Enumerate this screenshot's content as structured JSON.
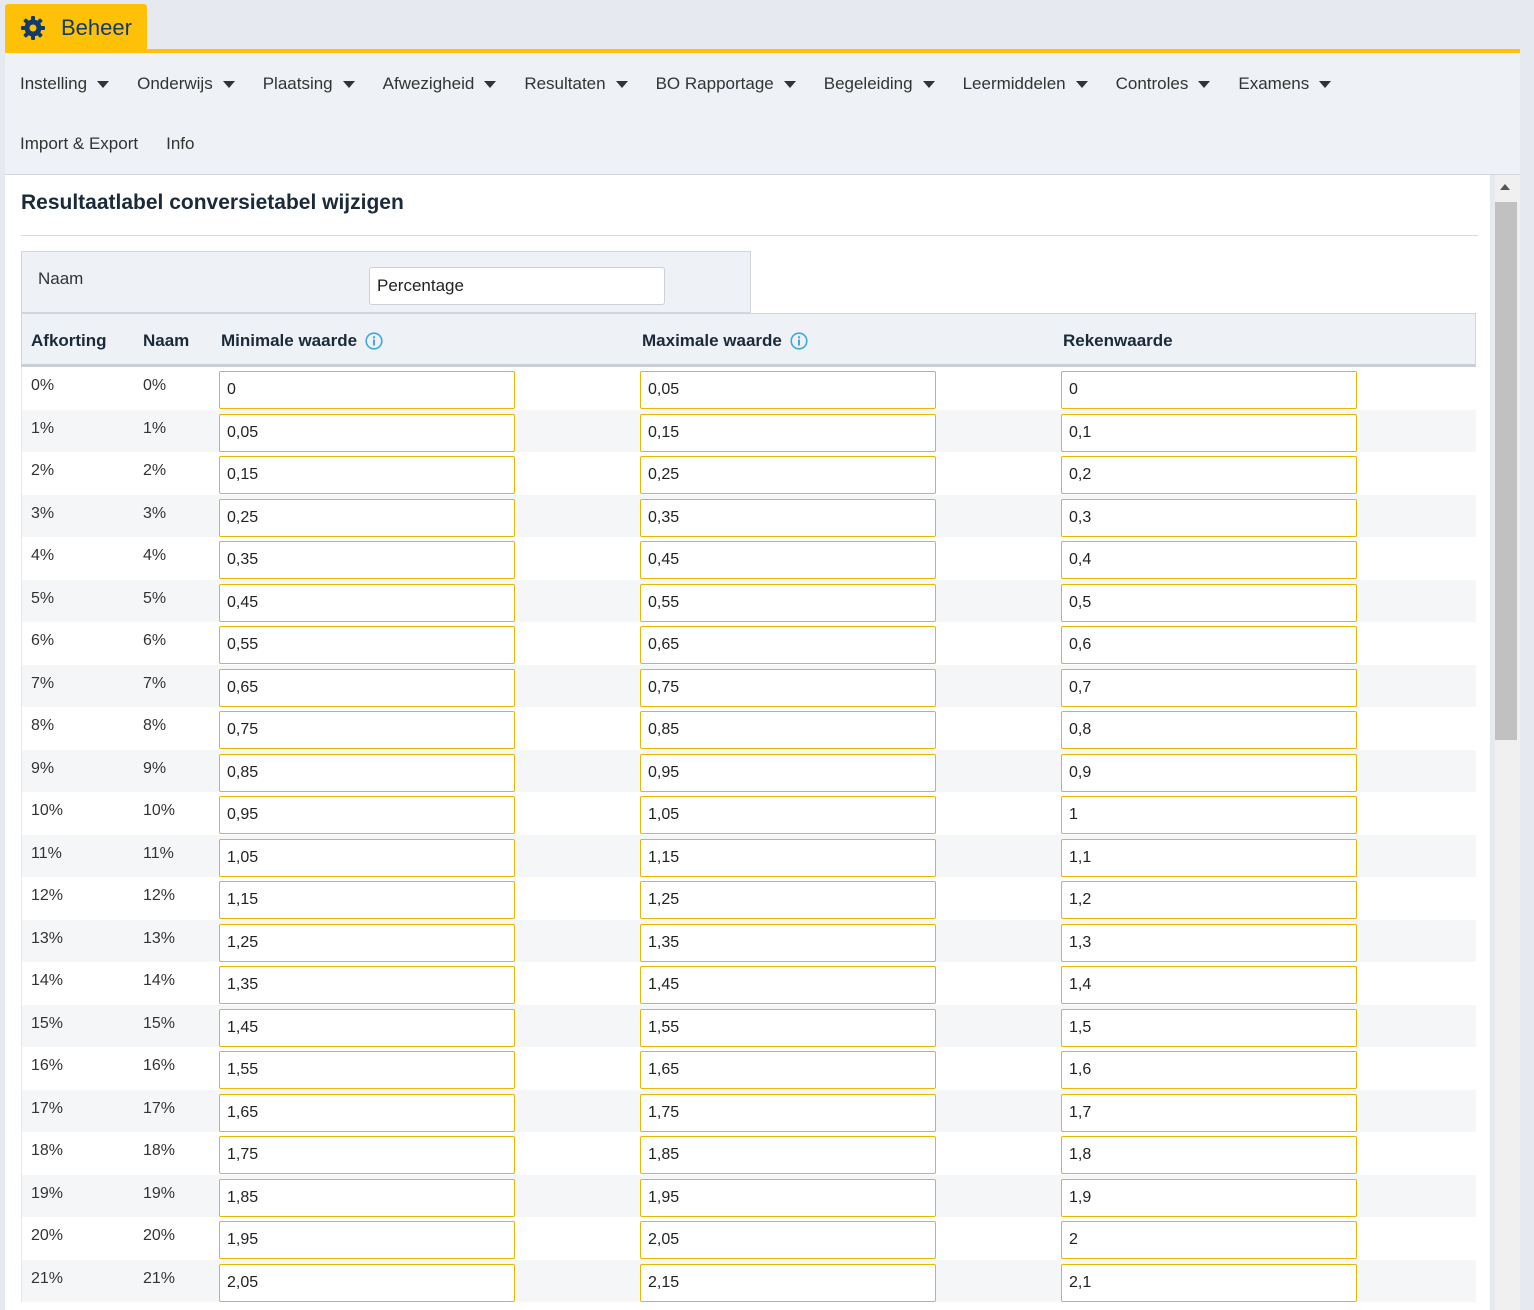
{
  "app": {
    "tab_label": "Beheer"
  },
  "menu": {
    "row1": [
      "Instelling",
      "Onderwijs",
      "Plaatsing",
      "Afwezigheid",
      "Resultaten",
      "BO Rapportage",
      "Begeleiding",
      "Leermiddelen",
      "Controles",
      "Examens"
    ],
    "row2": [
      "Import & Export",
      "Info"
    ]
  },
  "page": {
    "title": "Resultaatlabel conversietabel wijzigen"
  },
  "form": {
    "naam_label": "Naam",
    "naam_value": "Percentage"
  },
  "table": {
    "headers": {
      "afkorting": "Afkorting",
      "naam": "Naam",
      "min": "Minimale waarde",
      "max": "Maximale waarde",
      "reken": "Rekenwaarde"
    },
    "rows": [
      [
        "0%",
        "0%",
        "0",
        "0,05",
        "0"
      ],
      [
        "1%",
        "1%",
        "0,05",
        "0,15",
        "0,1"
      ],
      [
        "2%",
        "2%",
        "0,15",
        "0,25",
        "0,2"
      ],
      [
        "3%",
        "3%",
        "0,25",
        "0,35",
        "0,3"
      ],
      [
        "4%",
        "4%",
        "0,35",
        "0,45",
        "0,4"
      ],
      [
        "5%",
        "5%",
        "0,45",
        "0,55",
        "0,5"
      ],
      [
        "6%",
        "6%",
        "0,55",
        "0,65",
        "0,6"
      ],
      [
        "7%",
        "7%",
        "0,65",
        "0,75",
        "0,7"
      ],
      [
        "8%",
        "8%",
        "0,75",
        "0,85",
        "0,8"
      ],
      [
        "9%",
        "9%",
        "0,85",
        "0,95",
        "0,9"
      ],
      [
        "10%",
        "10%",
        "0,95",
        "1,05",
        "1"
      ],
      [
        "11%",
        "11%",
        "1,05",
        "1,15",
        "1,1"
      ],
      [
        "12%",
        "12%",
        "1,15",
        "1,25",
        "1,2"
      ],
      [
        "13%",
        "13%",
        "1,25",
        "1,35",
        "1,3"
      ],
      [
        "14%",
        "14%",
        "1,35",
        "1,45",
        "1,4"
      ],
      [
        "15%",
        "15%",
        "1,45",
        "1,55",
        "1,5"
      ],
      [
        "16%",
        "16%",
        "1,55",
        "1,65",
        "1,6"
      ],
      [
        "17%",
        "17%",
        "1,65",
        "1,75",
        "1,7"
      ],
      [
        "18%",
        "18%",
        "1,75",
        "1,85",
        "1,8"
      ],
      [
        "19%",
        "19%",
        "1,85",
        "1,95",
        "1,9"
      ],
      [
        "20%",
        "20%",
        "1,95",
        "2,05",
        "2"
      ],
      [
        "21%",
        "21%",
        "2,05",
        "2,15",
        "2,1"
      ]
    ]
  },
  "colors": {
    "accent": "#ffc107",
    "brand_text": "#123a6b",
    "input_border": "#e6b800",
    "info_icon": "#3fa9dc"
  },
  "icons": {
    "tab": "gear-icon",
    "header_info": "info-icon",
    "menu_caret": "caret-down-icon"
  }
}
